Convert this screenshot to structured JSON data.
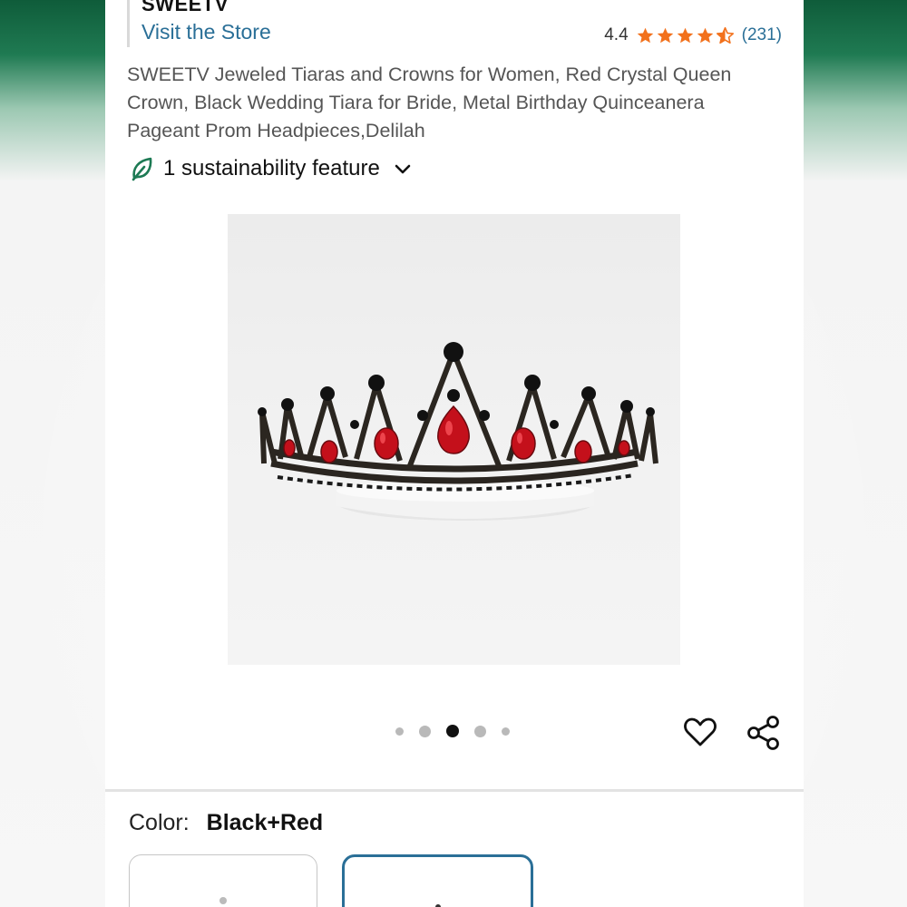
{
  "store": {
    "brand": "SWEETV",
    "visit_label": "Visit the Store"
  },
  "rating": {
    "value": "4.4",
    "stars": 4.4,
    "count": "(231)"
  },
  "product": {
    "title": "SWEETV Jeweled Tiaras and Crowns for Women, Red Crystal Queen Crown, Black Wedding Tiara for Bride, Metal Birthday Quinceanera Pageant Prom Headpieces,Delilah"
  },
  "sustainability": {
    "label": "1 sustainability feature",
    "icon": "leaf-icon"
  },
  "carousel": {
    "total": 5,
    "active_index": 2
  },
  "actions": {
    "wishlist_icon": "heart-icon",
    "share_icon": "share-icon"
  },
  "color": {
    "label": "Color:",
    "value": "Black+Red",
    "selected_swatch": 2
  },
  "colors": {
    "link": "#2a6f97",
    "star": "#f2711c",
    "leaf": "#1d7a54",
    "selected_border": "#2a6f97"
  }
}
